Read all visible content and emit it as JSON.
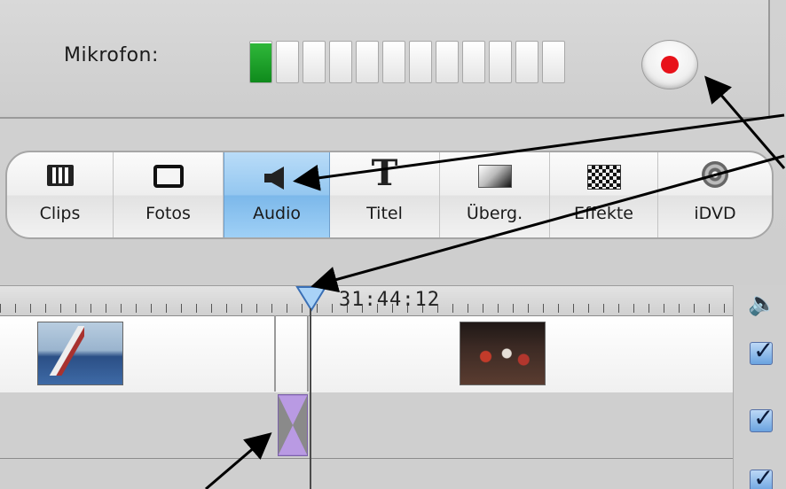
{
  "mic": {
    "label": "Mikrofon:",
    "meter_segments": 12,
    "meter_level": 0.08
  },
  "toolbar": {
    "items": [
      {
        "label": "Clips",
        "icon": "clips-icon"
      },
      {
        "label": "Fotos",
        "icon": "photos-icon"
      },
      {
        "label": "Audio",
        "icon": "speaker-icon",
        "active": true
      },
      {
        "label": "Titel",
        "icon": "title-t-icon"
      },
      {
        "label": "Überg.",
        "icon": "transition-icon"
      },
      {
        "label": "Effekte",
        "icon": "checkerboard-effects-icon"
      },
      {
        "label": "iDVD",
        "icon": "disc-icon"
      }
    ]
  },
  "timeline": {
    "timecode": "31:44:12"
  },
  "colors": {
    "accent_selected": "#94c7f0",
    "record_red": "#e8121a",
    "meter_green": "#1ca32a",
    "transition_purple": "#a98ad6"
  }
}
